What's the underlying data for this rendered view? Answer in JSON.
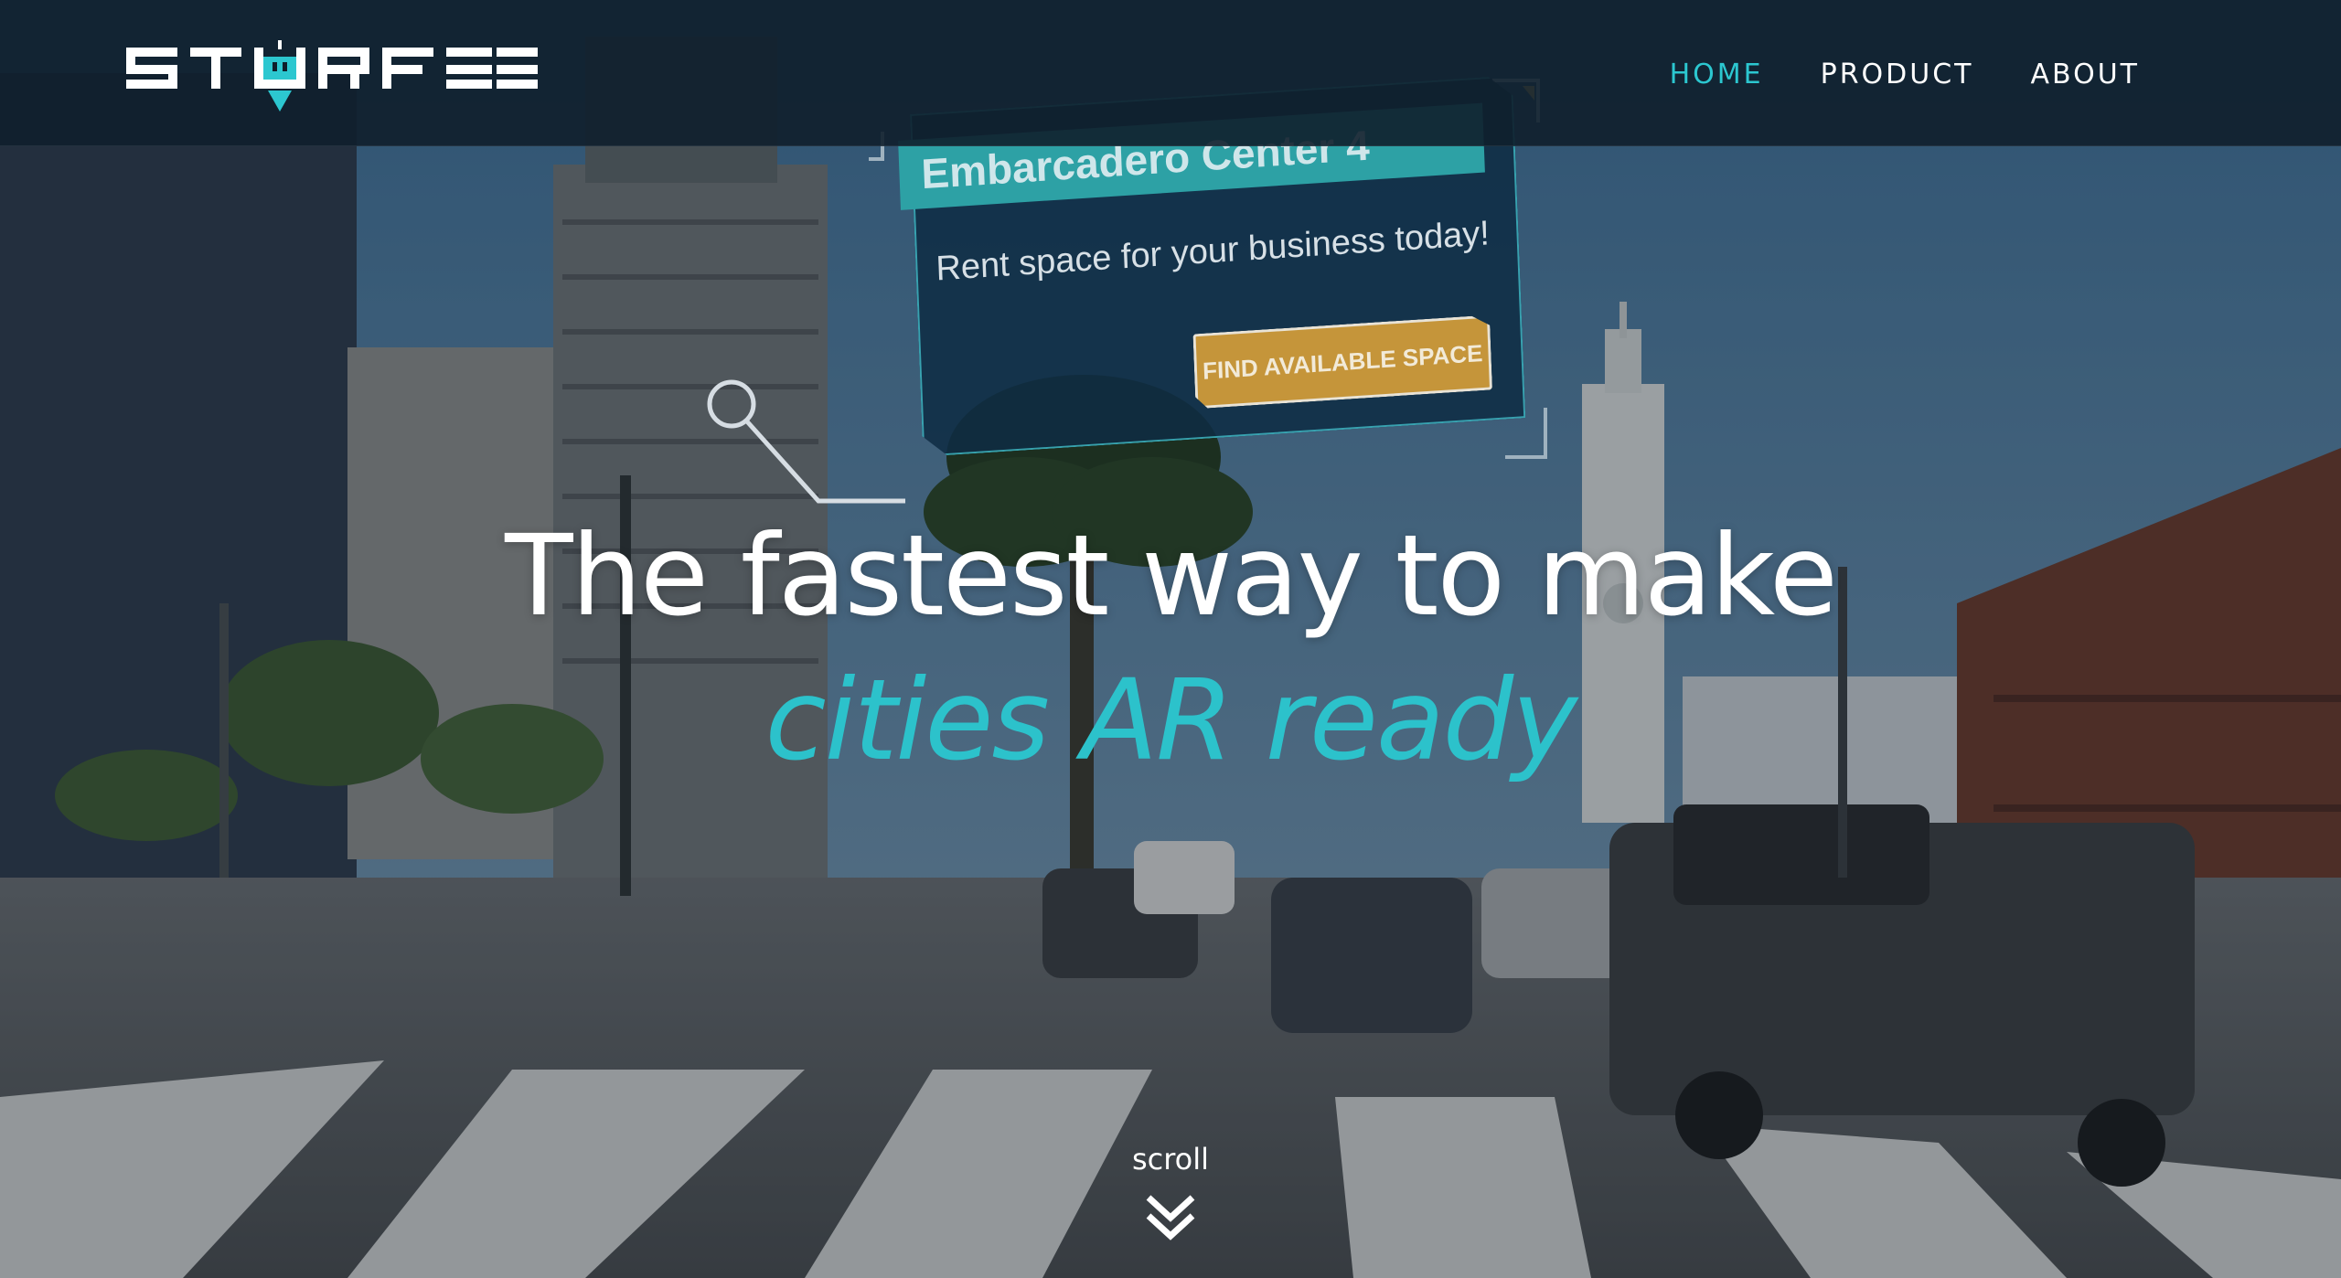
{
  "nav": {
    "logo_text": "STURFEE",
    "links": [
      {
        "label": "HOME",
        "active": true
      },
      {
        "label": "PRODUCT",
        "active": false
      },
      {
        "label": "ABOUT",
        "active": false
      }
    ]
  },
  "hero": {
    "background_scene": "San Francisco street (Embarcadero) with buildings, palm tree, clock tower and traffic",
    "headline": "The fastest way to make",
    "subheadline": "cities AR ready"
  },
  "ar_card": {
    "title": "Embarcadero Center 4",
    "text": "Rent space for your business today!",
    "button_label": "FIND AVAILABLE SPACE"
  },
  "scroll_hint": {
    "label": "scroll",
    "icon": "double-chevron-down-icon"
  },
  "colors": {
    "accent": "#2cc7d0",
    "nav_background": "#101f2c",
    "ar_title_bg": "#2da1a5",
    "ar_button_bg": "#c5953a",
    "text": "#ffffff"
  }
}
